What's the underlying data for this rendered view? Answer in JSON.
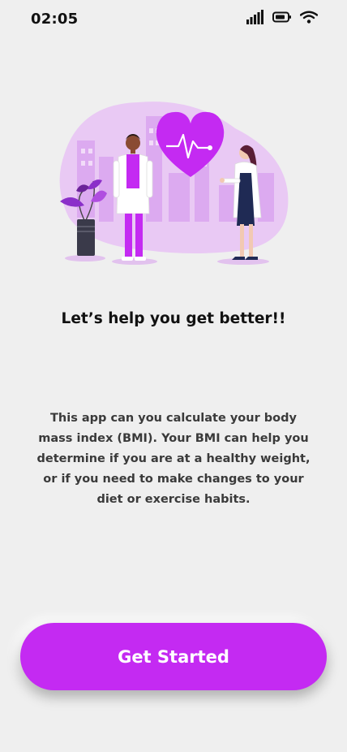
{
  "status_bar": {
    "time": "02:05",
    "icons": [
      "signal-icon",
      "battery-icon",
      "wifi-icon"
    ]
  },
  "onboarding": {
    "headline": "Let’s help you get better!!",
    "description": "This app can you calculate your body mass index (BMI). Your BMI can help you determine if you are at a healthy weight, or if you need to make changes to your diet or exercise habits.",
    "cta_label": "Get Started"
  },
  "colors": {
    "background": "#efefef",
    "accent": "#c42af2",
    "accent_light": "#e7c6f3",
    "text": "#111111"
  }
}
